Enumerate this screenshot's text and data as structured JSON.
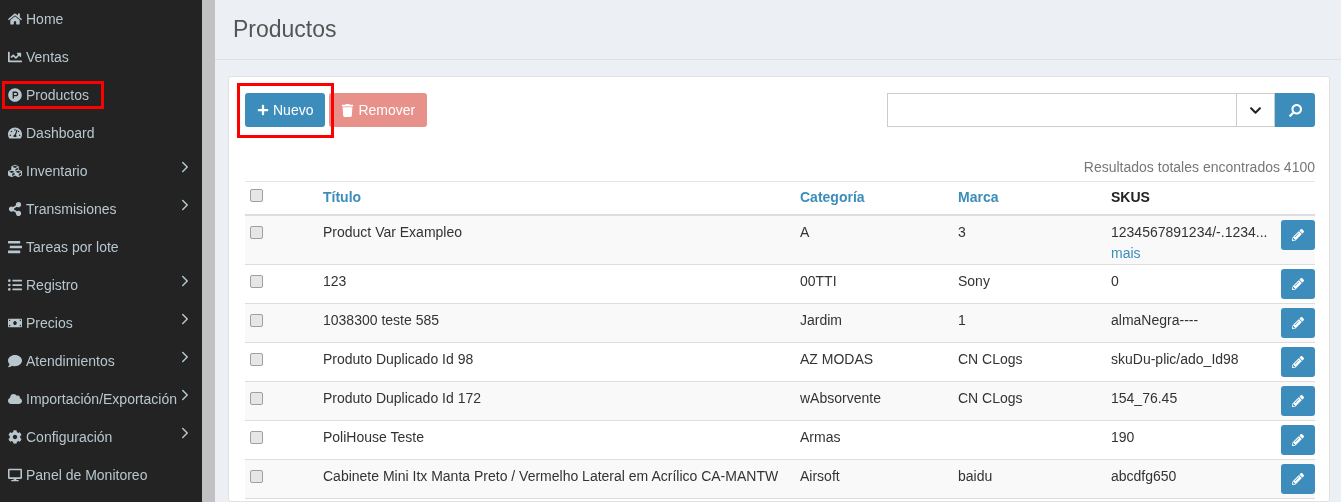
{
  "sidebar": {
    "items": [
      {
        "label": "Home",
        "expandable": false,
        "highlighted": false
      },
      {
        "label": "Ventas",
        "expandable": false,
        "highlighted": false
      },
      {
        "label": "Productos",
        "expandable": false,
        "highlighted": true
      },
      {
        "label": "Dashboard",
        "expandable": false,
        "highlighted": false
      },
      {
        "label": "Inventario",
        "expandable": true,
        "highlighted": false
      },
      {
        "label": "Transmisiones",
        "expandable": true,
        "highlighted": false
      },
      {
        "label": "Tareas por lote",
        "expandable": false,
        "highlighted": false
      },
      {
        "label": "Registro",
        "expandable": true,
        "highlighted": false
      },
      {
        "label": "Precios",
        "expandable": true,
        "highlighted": false
      },
      {
        "label": "Atendimientos",
        "expandable": true,
        "highlighted": false
      },
      {
        "label": "Importación/Exportación",
        "expandable": true,
        "highlighted": false
      },
      {
        "label": "Configuración",
        "expandable": true,
        "highlighted": false
      },
      {
        "label": "Panel de Monitoreo",
        "expandable": false,
        "highlighted": false
      }
    ]
  },
  "page_title": "Productos",
  "toolbar": {
    "new_button": {
      "label": "Nuevo",
      "highlighted": true
    },
    "remove_button": {
      "label": "Remover",
      "disabled": true
    }
  },
  "results_text": "Resultados totales encontrados 4100",
  "table": {
    "header_checked": false,
    "columns": [
      {
        "label": "Título",
        "sortable": true
      },
      {
        "label": "Categoría",
        "sortable": true
      },
      {
        "label": "Marca",
        "sortable": true
      },
      {
        "label": "SKUS",
        "sortable": false
      }
    ],
    "rows": [
      {
        "checked": false,
        "title": "Product Var Exampleo",
        "category": "A",
        "brand": "3",
        "sku": "1234567891234/-.1234...",
        "more_link": "mais"
      },
      {
        "checked": false,
        "title": "123",
        "category": "00TTI",
        "brand": "Sony",
        "sku": "0"
      },
      {
        "checked": false,
        "title": "1038300 teste 585",
        "category": "Jardim",
        "brand": "1",
        "sku": "almaNegra----"
      },
      {
        "checked": false,
        "title": "Produto Duplicado Id 98",
        "category": "AZ MODAS",
        "brand": "CN CLogs",
        "sku": "skuDu-plic/ado_Id98"
      },
      {
        "checked": false,
        "title": "Produto Duplicado Id 172",
        "category": "wAbsorvente",
        "brand": "CN CLogs",
        "sku": "154_76.45"
      },
      {
        "checked": false,
        "title": "PoliHouse Teste",
        "category": "Armas",
        "sku": "190"
      },
      {
        "checked": false,
        "title": "Cabinete Mini Itx Manta Preto / Vermelho Lateral em Acrílico CA-MANTW",
        "category": "Airsoft",
        "brand": "baidu",
        "sku": "abcdfg650"
      }
    ]
  }
}
